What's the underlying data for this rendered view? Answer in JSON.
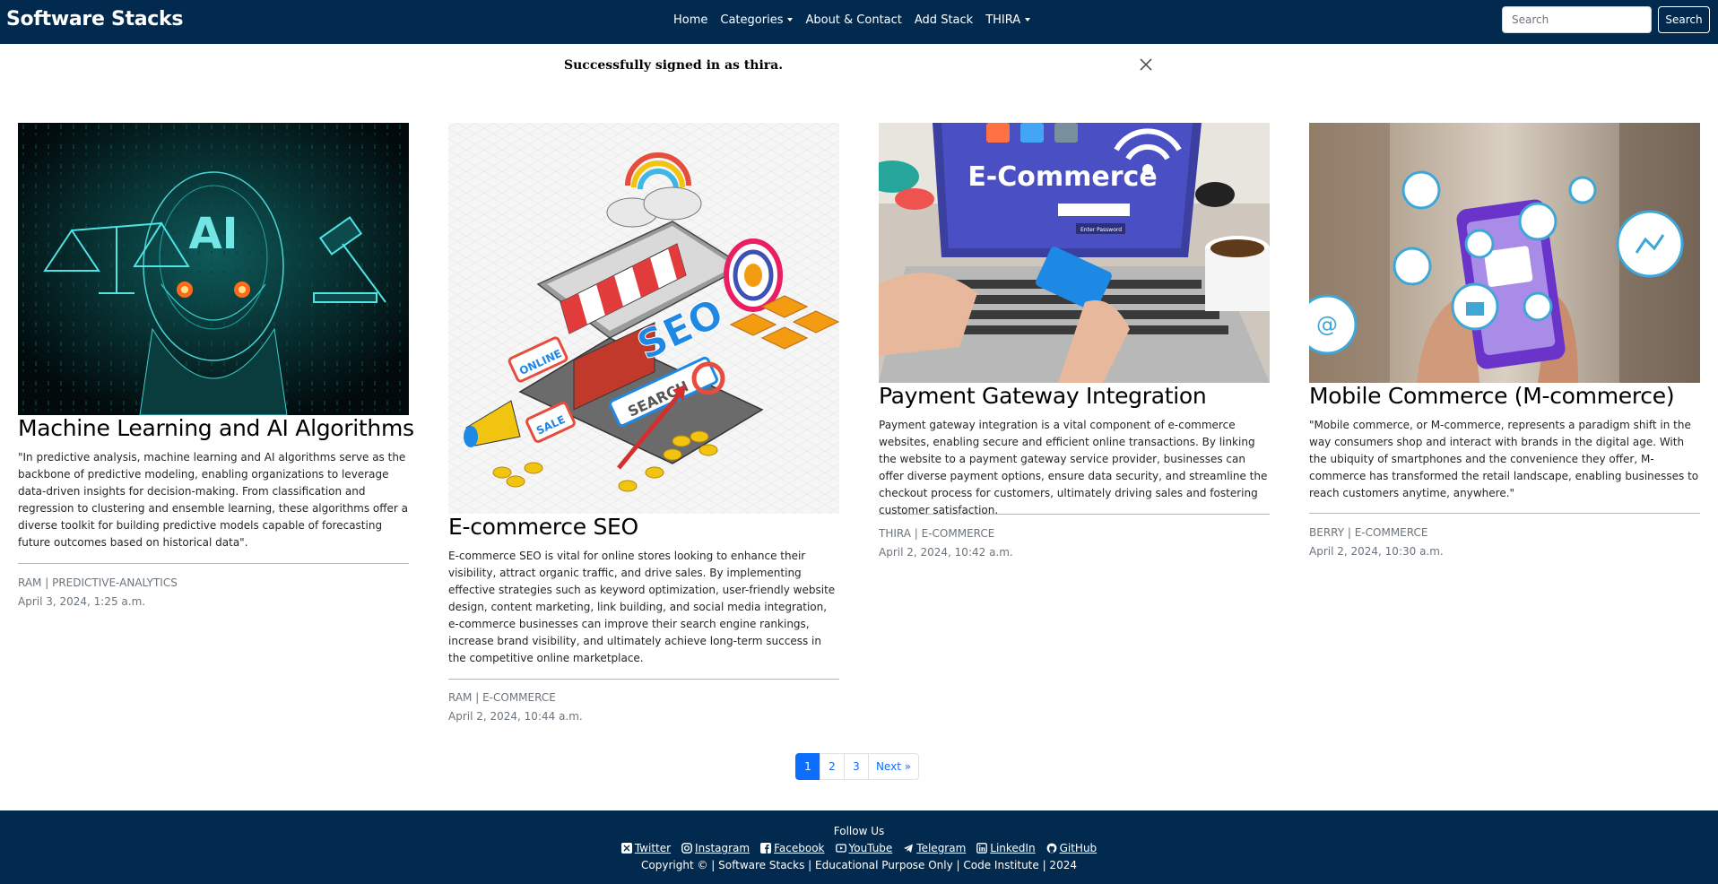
{
  "navbar": {
    "brand": "Software Stacks",
    "links": {
      "home": "Home",
      "categories": "Categories",
      "about": "About & Contact",
      "add_stack": "Add Stack",
      "user": "THIRA"
    },
    "search_placeholder": "Search",
    "search_button": "Search",
    "colors": {
      "background": "#022a4f"
    }
  },
  "alert": {
    "message": "Successfully signed in as thira."
  },
  "posts": [
    {
      "title": "Machine Learning and AI Algorithms",
      "excerpt": "\"In predictive analysis, machine learning and AI algorithms serve as the backbone of predictive modeling, enabling organizations to leverage data-driven insights for decision-making. From classification and regression to clustering and ensemble learning, these algorithms offer a diverse toolkit for building predictive models capable of forecasting future outcomes based on historical data\".",
      "meta": "RAM | PREDICTIVE-ANALYTICS",
      "date": "April 3, 2024, 1:25 a.m."
    },
    {
      "title": "E-commerce SEO",
      "excerpt": "E-commerce SEO is vital for online stores looking to enhance their visibility, attract organic traffic, and drive sales. By implementing effective strategies such as keyword optimization, user-friendly website design, content marketing, link building, and social media integration, e-commerce businesses can improve their search engine rankings, increase brand visibility, and ultimately achieve long-term success in the competitive online marketplace.",
      "meta": "RAM | E-COMMERCE",
      "date": "April 2, 2024, 10:44 a.m.",
      "image_text": {
        "seo": "SEO",
        "search": "SEARCH",
        "online": "ONLINE",
        "sale": "SALE"
      }
    },
    {
      "title": "Payment Gateway Integration",
      "excerpt": "Payment gateway integration is a vital component of e-commerce websites, enabling secure and efficient online transactions. By linking the website to a payment gateway service provider, businesses can offer diverse payment options, ensure data security, and streamline the checkout process for customers, ultimately driving sales and fostering customer satisfaction.",
      "meta": "THIRA | E-COMMERCE",
      "date": "April 2, 2024, 10:42 a.m.",
      "image_text": {
        "screen_title": "E-Commerce",
        "field": "Enter Password"
      }
    },
    {
      "title": "Mobile Commerce (M-commerce)",
      "excerpt": "\"Mobile commerce, or M-commerce, represents a paradigm shift in the way consumers shop and interact with brands in the digital age. With the ubiquity of smartphones and the convenience they offer, M-commerce has transformed the retail landscape, enabling businesses to reach customers anytime, anywhere.\"",
      "meta": "BERRY | E-COMMERCE",
      "date": "April 2, 2024, 10:30 a.m."
    }
  ],
  "pagination": {
    "pages": [
      "1",
      "2",
      "3"
    ],
    "current": "1",
    "next": "Next »"
  },
  "footer": {
    "follow": "Follow Us",
    "social": {
      "twitter": "Twitter",
      "instagram": "Instagram",
      "facebook": "Facebook",
      "youtube": "YouTube",
      "telegram": "Telegram",
      "linkedin": "LinkedIn",
      "github": "GitHub"
    },
    "copyright": "Copyright © | Software Stacks | Educational Purpose Only | Code Institute | 2024"
  }
}
